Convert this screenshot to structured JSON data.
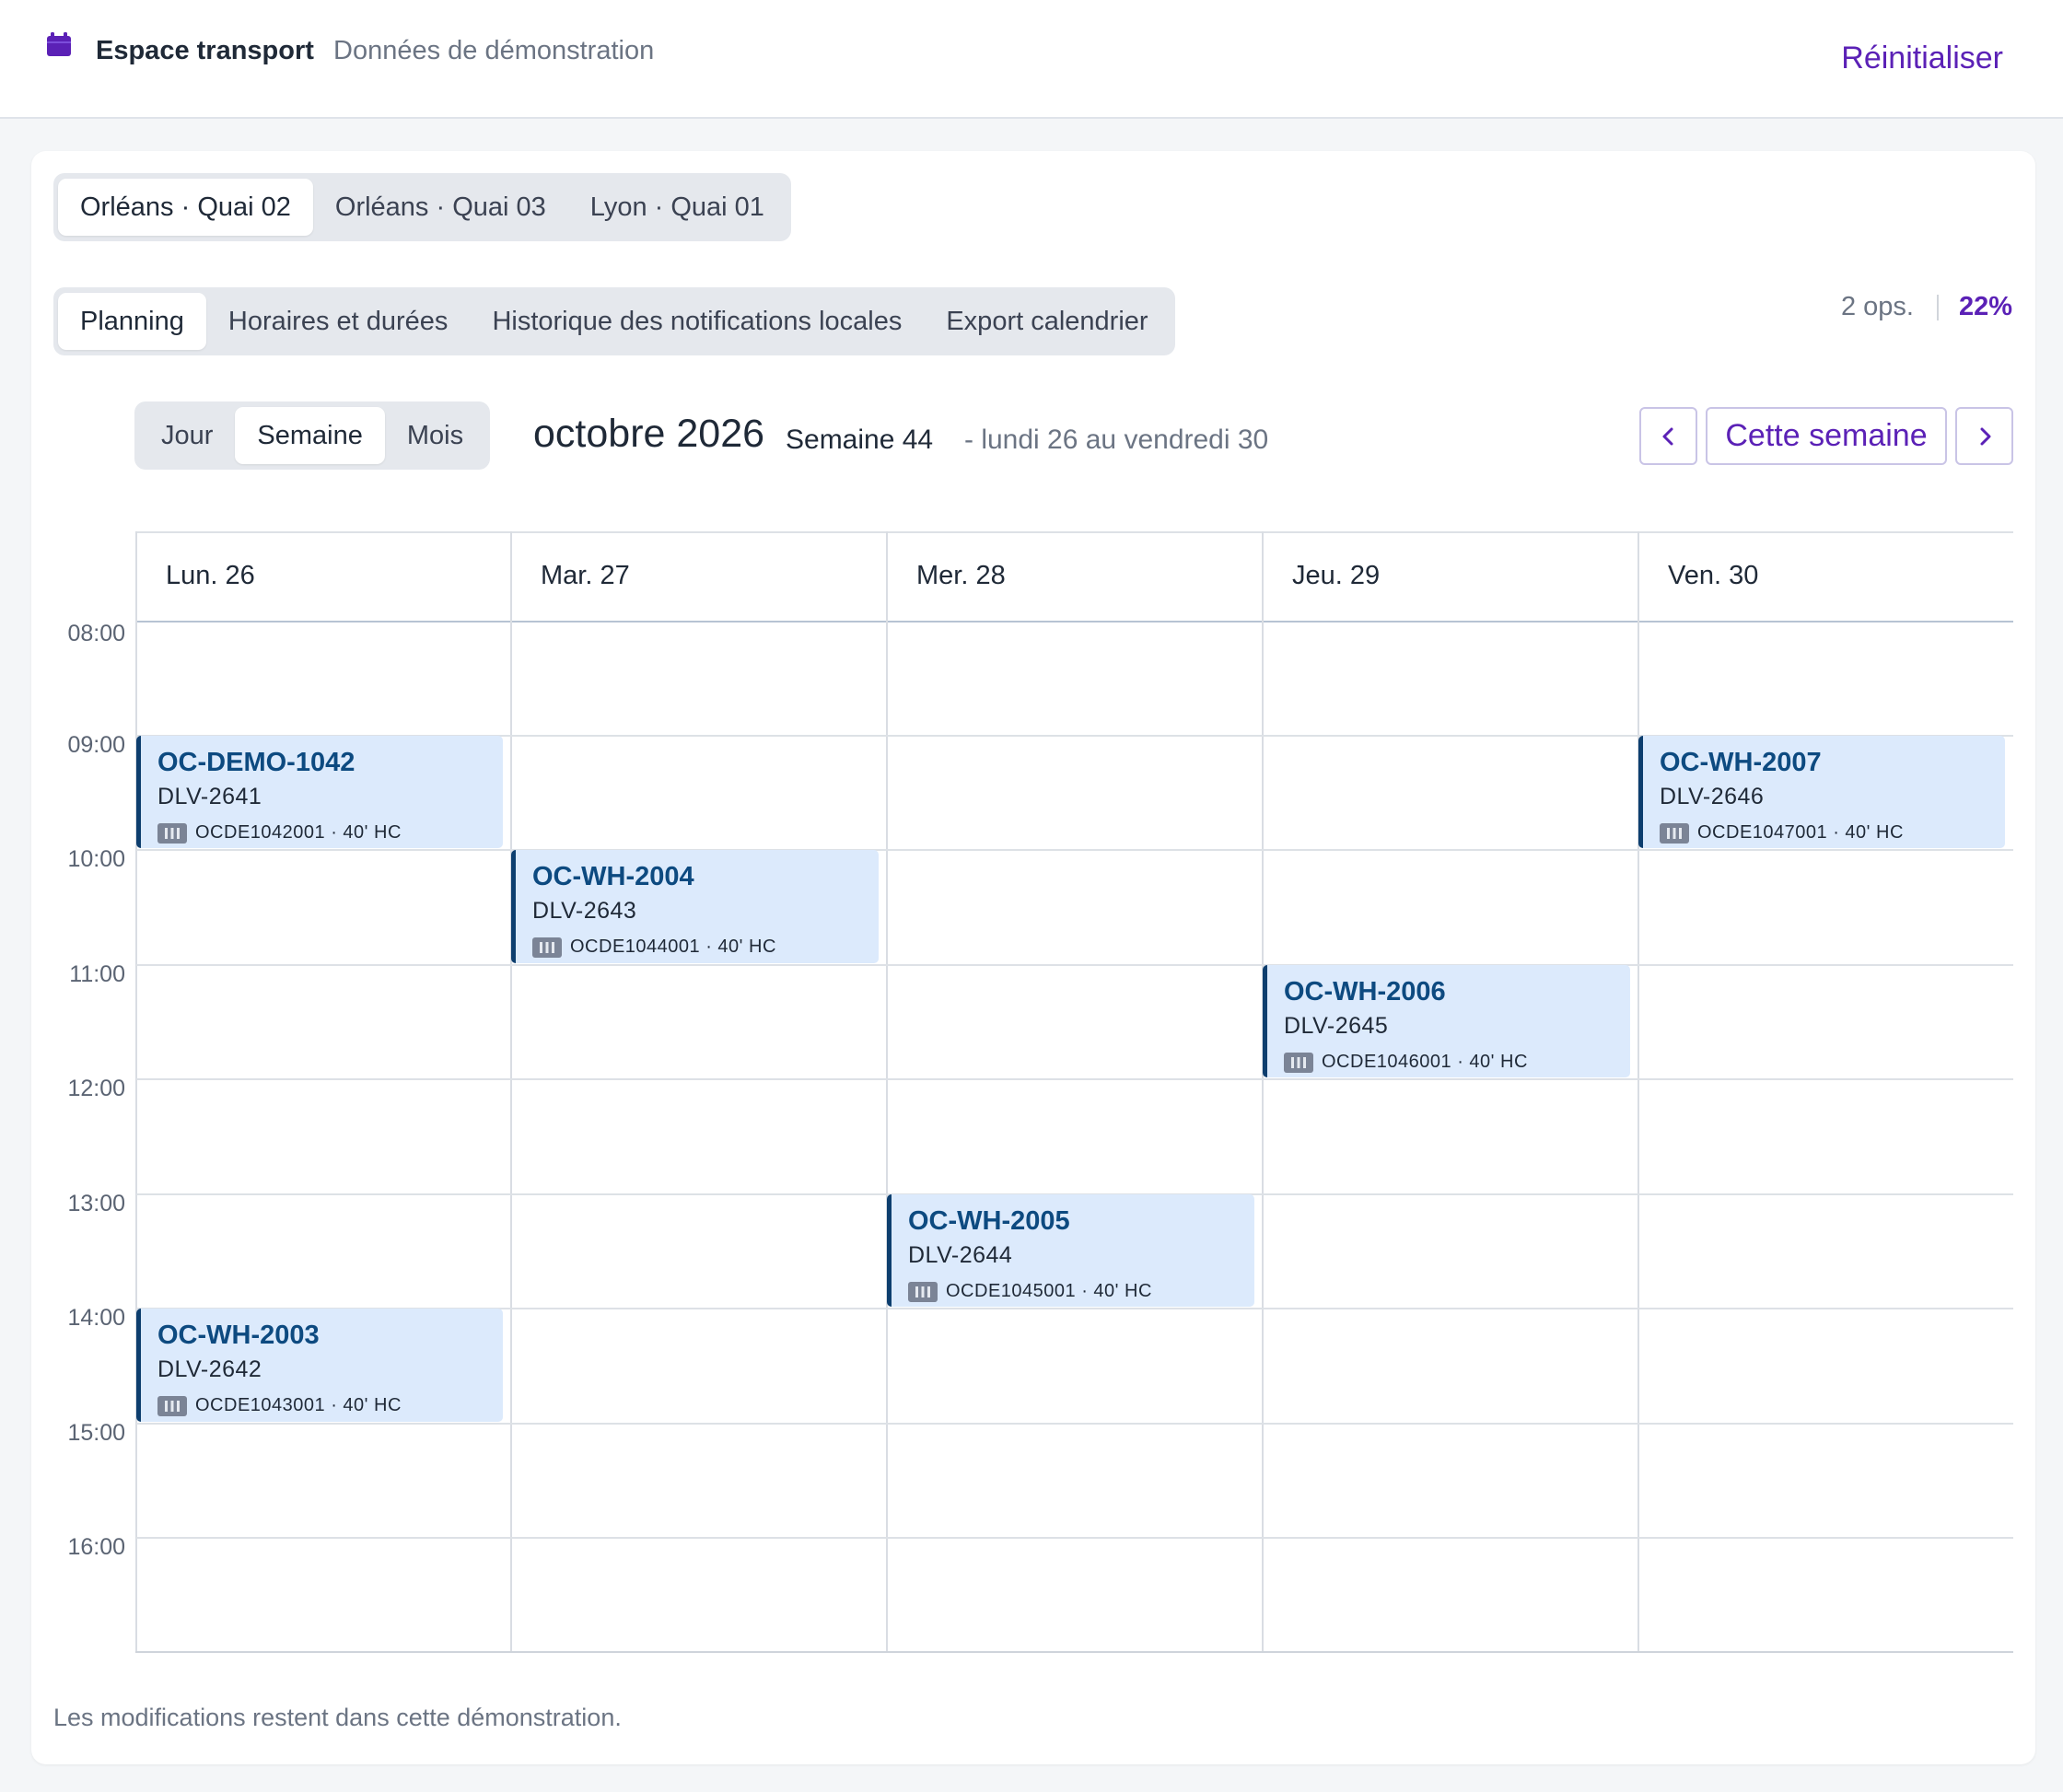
{
  "header": {
    "brand_title": "Espace transport",
    "brand_subtitle": "Données de démonstration",
    "reset_label": "Réinitialiser",
    "accent_color": "#5b21b6"
  },
  "docks": [
    {
      "label": "Orléans · Quai 02",
      "active": true
    },
    {
      "label": "Orléans · Quai 03",
      "active": false
    },
    {
      "label": "Lyon · Quai 01",
      "active": false
    }
  ],
  "tabs": [
    {
      "label": "Planning",
      "active": true
    },
    {
      "label": "Horaires et durées",
      "active": false
    },
    {
      "label": "Historique des notifications locales",
      "active": false
    },
    {
      "label": "Export calendrier",
      "active": false
    }
  ],
  "stats": {
    "ops": "2 ops.",
    "percent": "22%"
  },
  "views": [
    {
      "label": "Jour",
      "active": false
    },
    {
      "label": "Semaine",
      "active": true
    },
    {
      "label": "Mois",
      "active": false
    }
  ],
  "period": {
    "month": "octobre 2026",
    "week": "Semaine 44",
    "range": "- lundi 26 au vendredi 30",
    "today_label": "Cette semaine",
    "prev_icon": "chevron-left-icon",
    "next_icon": "chevron-right-icon"
  },
  "calendar": {
    "days": [
      "Lun. 26",
      "Mar. 27",
      "Mer. 28",
      "Jeu. 29",
      "Ven. 30"
    ],
    "hours": [
      "08:00",
      "09:00",
      "10:00",
      "11:00",
      "12:00",
      "13:00",
      "14:00",
      "15:00",
      "16:00"
    ],
    "events": [
      {
        "day": 0,
        "start": "09:00",
        "end": "10:00",
        "title": "OC-DEMO-1042",
        "ref": "DLV-2641",
        "container": "OCDE1042001 · 40' HC",
        "icon": "container-icon"
      },
      {
        "day": 1,
        "start": "10:00",
        "end": "11:00",
        "title": "OC-WH-2004",
        "ref": "DLV-2643",
        "container": "OCDE1044001 · 40' HC",
        "icon": "container-icon"
      },
      {
        "day": 3,
        "start": "11:00",
        "end": "12:00",
        "title": "OC-WH-2006",
        "ref": "DLV-2645",
        "container": "OCDE1046001 · 40' HC",
        "icon": "container-icon"
      },
      {
        "day": 2,
        "start": "13:00",
        "end": "14:00",
        "title": "OC-WH-2005",
        "ref": "DLV-2644",
        "container": "OCDE1045001 · 40' HC",
        "icon": "container-icon"
      },
      {
        "day": 0,
        "start": "14:00",
        "end": "15:00",
        "title": "OC-WH-2003",
        "ref": "DLV-2642",
        "container": "OCDE1043001 · 40' HC",
        "icon": "container-icon"
      },
      {
        "day": 4,
        "start": "09:00",
        "end": "10:00",
        "title": "OC-WH-2007",
        "ref": "DLV-2646",
        "container": "OCDE1047001 · 40' HC",
        "icon": "container-icon"
      }
    ]
  },
  "footer": {
    "note": "Les modifications restent dans cette démonstration."
  }
}
